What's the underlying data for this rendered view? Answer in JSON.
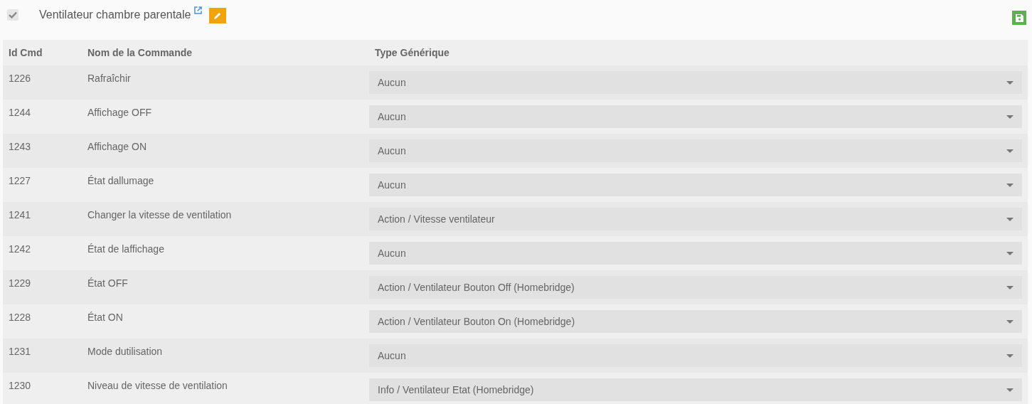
{
  "header": {
    "checked": true,
    "title": "Ventilateur chambre parentale"
  },
  "table": {
    "columns": [
      "Id Cmd",
      "Nom de la Commande",
      "Type Générique"
    ],
    "rows": [
      {
        "id": "1226",
        "name": "Rafraîchir",
        "type": "Aucun"
      },
      {
        "id": "1244",
        "name": "Affichage OFF",
        "type": "Aucun"
      },
      {
        "id": "1243",
        "name": "Affichage ON",
        "type": "Aucun"
      },
      {
        "id": "1227",
        "name": "État dallumage",
        "type": "Aucun"
      },
      {
        "id": "1241",
        "name": "Changer la vitesse de ventilation",
        "type": "Action / Vitesse ventilateur"
      },
      {
        "id": "1242",
        "name": "État de laffichage",
        "type": "Aucun"
      },
      {
        "id": "1229",
        "name": "État OFF",
        "type": "Action / Ventilateur Bouton Off (Homebridge)"
      },
      {
        "id": "1228",
        "name": "État ON",
        "type": "Action / Ventilateur Bouton On (Homebridge)"
      },
      {
        "id": "1231",
        "name": "Mode dutilisation",
        "type": "Aucun"
      },
      {
        "id": "1230",
        "name": "Niveau de vitesse de ventilation",
        "type": "Info / Ventilateur Etat (Homebridge)"
      }
    ]
  }
}
